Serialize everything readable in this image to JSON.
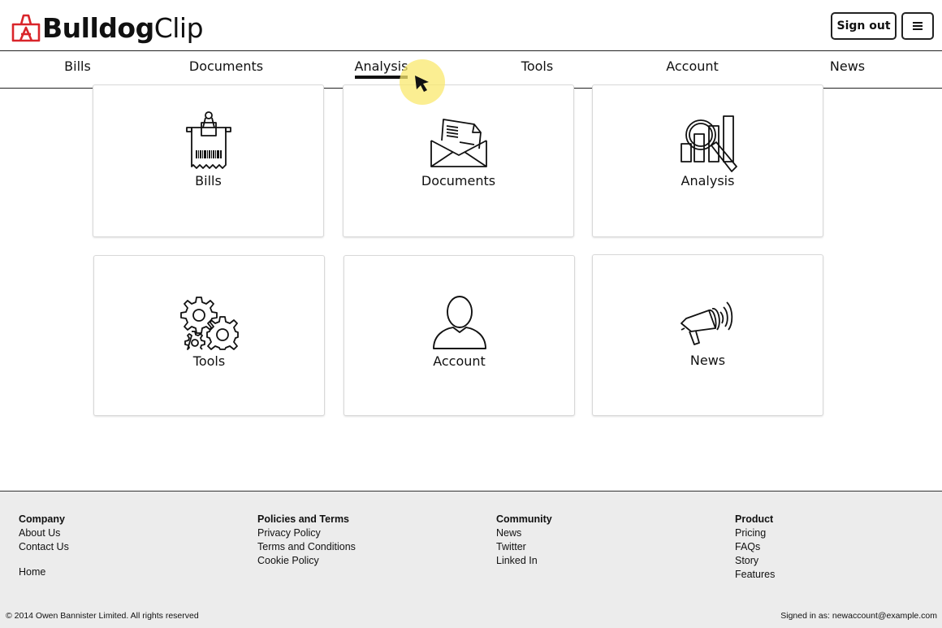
{
  "header": {
    "logo_bold": "Bulldog",
    "logo_light": "Clip",
    "signout_label": "Sign out",
    "menu_icon": "hamburger-menu-icon"
  },
  "nav": {
    "items": [
      {
        "label": "Bills",
        "active": false
      },
      {
        "label": "Documents",
        "active": false
      },
      {
        "label": "Analysis",
        "active": true
      },
      {
        "label": "Tools",
        "active": false
      },
      {
        "label": "Account",
        "active": false
      },
      {
        "label": "News",
        "active": false
      }
    ]
  },
  "cards": [
    {
      "label": "Bills",
      "icon": "bill-clip-icon"
    },
    {
      "label": "Documents",
      "icon": "envelope-documents-icon"
    },
    {
      "label": "Analysis",
      "icon": "magnifier-chart-icon"
    },
    {
      "label": "Tools",
      "icon": "gears-icon"
    },
    {
      "label": "Account",
      "icon": "user-icon"
    },
    {
      "label": "News",
      "icon": "megaphone-icon"
    }
  ],
  "footer": {
    "columns": [
      {
        "heading": "Company",
        "links": [
          "About Us",
          "Contact Us"
        ]
      },
      {
        "heading": "Policies and Terms",
        "links": [
          "Privacy Policy",
          "Terms and Conditions",
          "Cookie Policy"
        ]
      },
      {
        "heading": "Community",
        "links": [
          "News",
          "Twitter",
          "Linked In"
        ]
      },
      {
        "heading": "Product",
        "links": [
          "Pricing",
          "FAQs",
          "Story",
          "Features"
        ]
      }
    ],
    "home_link": "Home",
    "copyright": "© 2014 Owen Bannister Limited. All rights reserved",
    "signed_in": "Signed in as: newaccount@example.com"
  },
  "colors": {
    "logo_icon": "#d9252a",
    "cursor_halo": "#fae86e",
    "footer_bg": "#ececec"
  }
}
